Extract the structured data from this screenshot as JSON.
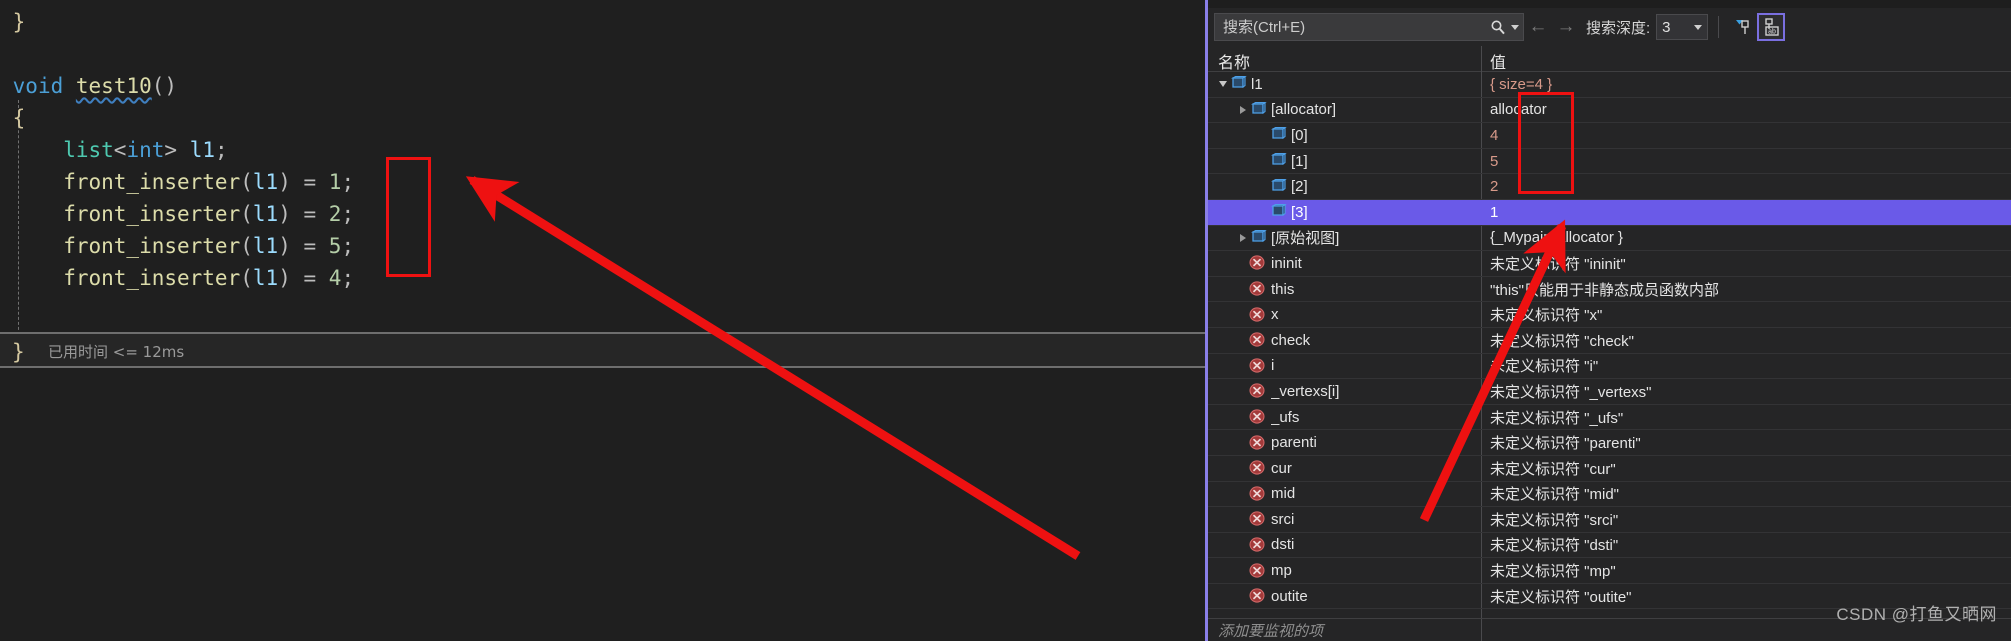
{
  "editor": {
    "code_lines": [
      {
        "indent": 0,
        "tokens": [
          {
            "t": "}",
            "c": "brace"
          }
        ]
      },
      {
        "indent": 0,
        "tokens": []
      },
      {
        "indent": 0,
        "tokens": [
          {
            "t": "void",
            "c": "key"
          },
          {
            "t": " ",
            "c": "punc"
          },
          {
            "t": "test10",
            "c": "fn-squiggle"
          },
          {
            "t": "()",
            "c": "punc"
          }
        ]
      },
      {
        "indent": 0,
        "tokens": [
          {
            "t": "{",
            "c": "brace"
          }
        ]
      },
      {
        "indent": 1,
        "tokens": [
          {
            "t": "list",
            "c": "type"
          },
          {
            "t": "<",
            "c": "punc"
          },
          {
            "t": "int",
            "c": "key"
          },
          {
            "t": "> ",
            "c": "punc"
          },
          {
            "t": "l1",
            "c": "var"
          },
          {
            "t": ";",
            "c": "punc"
          }
        ]
      },
      {
        "indent": 1,
        "tokens": [
          {
            "t": "front_inserter",
            "c": "fn"
          },
          {
            "t": "(",
            "c": "punc"
          },
          {
            "t": "l1",
            "c": "var"
          },
          {
            "t": ") ",
            "c": "punc"
          },
          {
            "t": "= ",
            "c": "punc"
          },
          {
            "t": "1",
            "c": "num"
          },
          {
            "t": ";",
            "c": "punc"
          }
        ]
      },
      {
        "indent": 1,
        "tokens": [
          {
            "t": "front_inserter",
            "c": "fn"
          },
          {
            "t": "(",
            "c": "punc"
          },
          {
            "t": "l1",
            "c": "var"
          },
          {
            "t": ") ",
            "c": "punc"
          },
          {
            "t": "= ",
            "c": "punc"
          },
          {
            "t": "2",
            "c": "num"
          },
          {
            "t": ";",
            "c": "punc"
          }
        ]
      },
      {
        "indent": 1,
        "tokens": [
          {
            "t": "front_inserter",
            "c": "fn"
          },
          {
            "t": "(",
            "c": "punc"
          },
          {
            "t": "l1",
            "c": "var"
          },
          {
            "t": ") ",
            "c": "punc"
          },
          {
            "t": "= ",
            "c": "punc"
          },
          {
            "t": "5",
            "c": "num"
          },
          {
            "t": ";",
            "c": "punc"
          }
        ]
      },
      {
        "indent": 1,
        "tokens": [
          {
            "t": "front_inserter",
            "c": "fn"
          },
          {
            "t": "(",
            "c": "punc"
          },
          {
            "t": "l1",
            "c": "var"
          },
          {
            "t": ") ",
            "c": "punc"
          },
          {
            "t": "= ",
            "c": "punc"
          },
          {
            "t": "4",
            "c": "num"
          },
          {
            "t": ";",
            "c": "punc"
          }
        ]
      }
    ],
    "closing_brace": "}",
    "elapsed_text": "已用时间 <= 12ms"
  },
  "watch": {
    "search": {
      "placeholder": "搜索(Ctrl+E)",
      "value": ""
    },
    "nav_back": "←",
    "nav_forward": "→",
    "depth_label": "搜索深度:",
    "depth_value": "3",
    "columns": {
      "name": "名称",
      "value": "值"
    },
    "rows": [
      {
        "indent": 0,
        "expander": "down",
        "icon": "cube-icon",
        "name": "l1",
        "value": "{ size=4 }",
        "value_muted": true,
        "selected": false
      },
      {
        "indent": 1,
        "expander": "right",
        "icon": "cube-icon",
        "name": "[allocator]",
        "value": "allocator",
        "value_muted": false,
        "selected": false
      },
      {
        "indent": 2,
        "expander": "none",
        "icon": "cube-icon",
        "name": "[0]",
        "value": "4",
        "value_muted": true,
        "selected": false
      },
      {
        "indent": 2,
        "expander": "none",
        "icon": "cube-icon",
        "name": "[1]",
        "value": "5",
        "value_muted": true,
        "selected": false
      },
      {
        "indent": 2,
        "expander": "none",
        "icon": "cube-icon",
        "name": "[2]",
        "value": "2",
        "value_muted": true,
        "selected": false
      },
      {
        "indent": 2,
        "expander": "none",
        "icon": "cube-icon",
        "name": "[3]",
        "value": "1",
        "value_muted": false,
        "selected": true
      },
      {
        "indent": 1,
        "expander": "right",
        "icon": "cube-icon",
        "name": "[原始视图]",
        "value": "{_Mypair=allocator }",
        "value_muted": false,
        "selected": false
      },
      {
        "indent": 1,
        "expander": "none",
        "icon": "error-icon",
        "name": "ininit",
        "value": "未定义标识符 \"ininit\"",
        "value_muted": false,
        "selected": false
      },
      {
        "indent": 1,
        "expander": "none",
        "icon": "error-icon",
        "name": "this",
        "value": "\"this\"只能用于非静态成员函数内部",
        "value_muted": false,
        "selected": false
      },
      {
        "indent": 1,
        "expander": "none",
        "icon": "error-icon",
        "name": "x",
        "value": "未定义标识符 \"x\"",
        "value_muted": false,
        "selected": false
      },
      {
        "indent": 1,
        "expander": "none",
        "icon": "error-icon",
        "name": "check",
        "value": "未定义标识符 \"check\"",
        "value_muted": false,
        "selected": false
      },
      {
        "indent": 1,
        "expander": "none",
        "icon": "error-icon",
        "name": "i",
        "value": "未定义标识符 \"i\"",
        "value_muted": false,
        "selected": false
      },
      {
        "indent": 1,
        "expander": "none",
        "icon": "error-icon",
        "name": "_vertexs[i]",
        "value": "未定义标识符 \"_vertexs\"",
        "value_muted": false,
        "selected": false
      },
      {
        "indent": 1,
        "expander": "none",
        "icon": "error-icon",
        "name": "_ufs",
        "value": "未定义标识符 \"_ufs\"",
        "value_muted": false,
        "selected": false
      },
      {
        "indent": 1,
        "expander": "none",
        "icon": "error-icon",
        "name": "parenti",
        "value": "未定义标识符 \"parenti\"",
        "value_muted": false,
        "selected": false
      },
      {
        "indent": 1,
        "expander": "none",
        "icon": "error-icon",
        "name": "cur",
        "value": "未定义标识符 \"cur\"",
        "value_muted": false,
        "selected": false
      },
      {
        "indent": 1,
        "expander": "none",
        "icon": "error-icon",
        "name": "mid",
        "value": "未定义标识符 \"mid\"",
        "value_muted": false,
        "selected": false
      },
      {
        "indent": 1,
        "expander": "none",
        "icon": "error-icon",
        "name": "srci",
        "value": "未定义标识符 \"srci\"",
        "value_muted": false,
        "selected": false
      },
      {
        "indent": 1,
        "expander": "none",
        "icon": "error-icon",
        "name": "dsti",
        "value": "未定义标识符 \"dsti\"",
        "value_muted": false,
        "selected": false
      },
      {
        "indent": 1,
        "expander": "none",
        "icon": "error-icon",
        "name": "mp",
        "value": "未定义标识符 \"mp\"",
        "value_muted": false,
        "selected": false
      },
      {
        "indent": 1,
        "expander": "none",
        "icon": "error-icon",
        "name": "outite",
        "value": "未定义标识符 \"outite\"",
        "value_muted": false,
        "selected": false
      }
    ],
    "add_watch_placeholder": "添加要监视的项"
  },
  "watermark": "CSDN @打鱼又晒网",
  "colors": {
    "annotation_red": "#ee1111",
    "selection_purple": "#6a5ae8",
    "panel_border": "#8a7fe8",
    "error_icon": "#a33a3a",
    "editor_bg": "#1f1f1f",
    "panel_bg": "#252526"
  }
}
